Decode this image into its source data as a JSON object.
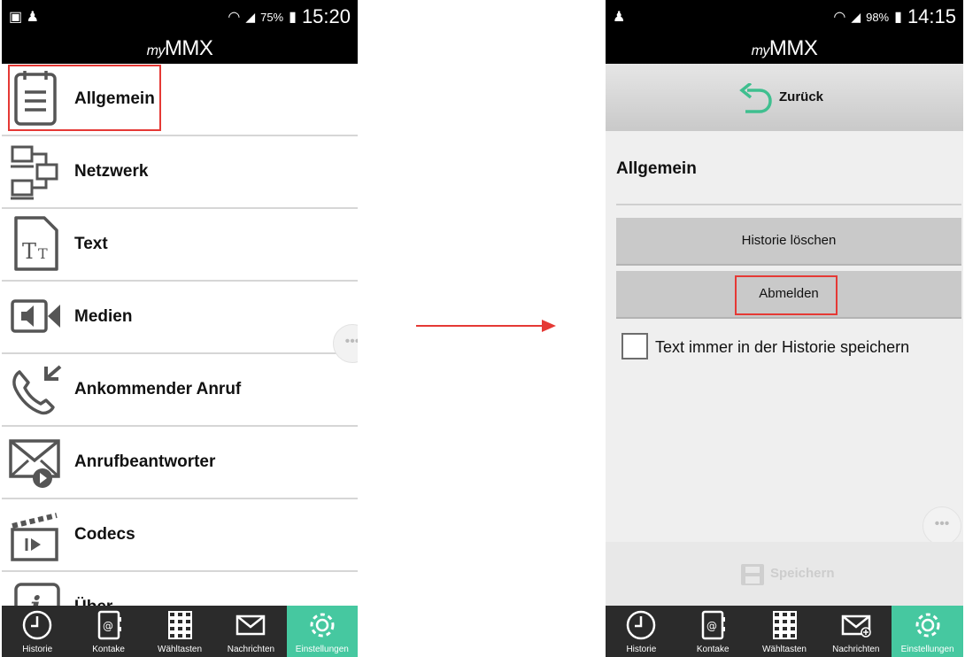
{
  "left": {
    "status": {
      "battery": "75%",
      "time": "15:20"
    },
    "app_title": {
      "prefix": "my",
      "name": "MMX"
    },
    "menu": [
      {
        "label": "Allgemein",
        "icon": "notepad-icon"
      },
      {
        "label": "Netzwerk",
        "icon": "network-icon"
      },
      {
        "label": "Text",
        "icon": "text-icon"
      },
      {
        "label": "Medien",
        "icon": "speaker-icon"
      },
      {
        "label": "Ankommender Anruf",
        "icon": "incoming-call-icon"
      },
      {
        "label": "Anrufbeantworter",
        "icon": "voicemail-icon"
      },
      {
        "label": "Codecs",
        "icon": "clapperboard-icon"
      },
      {
        "label": "Über",
        "icon": "info-icon"
      }
    ]
  },
  "right": {
    "status": {
      "battery": "98%",
      "time": "14:15"
    },
    "app_title": {
      "prefix": "my",
      "name": "MMX"
    },
    "back_label": "Zurück",
    "section_title": "Allgemein",
    "buttons": {
      "clear_history": "Historie löschen",
      "logout": "Abmelden"
    },
    "checkbox_label": "Text immer in der Historie speichern",
    "save_label": "Speichern"
  },
  "nav": [
    "Historie",
    "Kontake",
    "Wähltasten",
    "Nachrichten",
    "Einstellungen"
  ],
  "colors": {
    "accent": "#46c8a0",
    "highlight": "#e53935",
    "arrow": "#e53935"
  }
}
